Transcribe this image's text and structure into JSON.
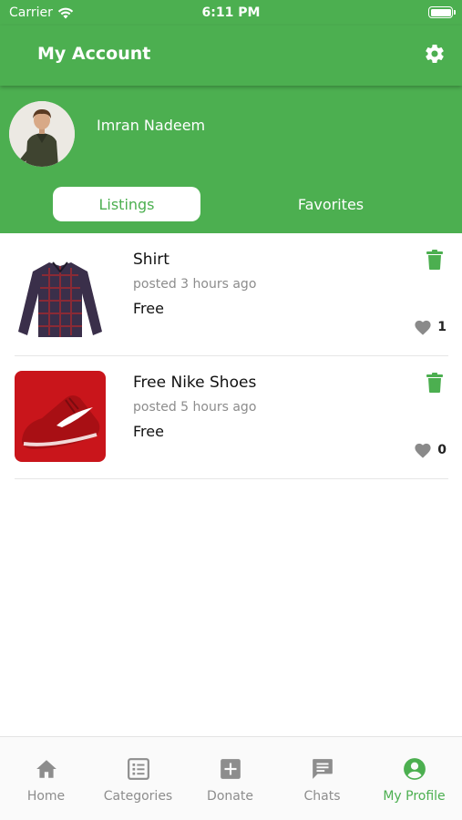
{
  "status_bar": {
    "carrier": "Carrier",
    "time": "6:11 PM"
  },
  "header": {
    "title": "My Account"
  },
  "profile": {
    "name": "Imran Nadeem"
  },
  "tabs": [
    {
      "label": "Listings",
      "active": true
    },
    {
      "label": "Favorites",
      "active": false
    }
  ],
  "listings": [
    {
      "title": "Shirt",
      "posted": "posted 3 hours ago",
      "price": "Free",
      "likes": "1"
    },
    {
      "title": "Free Nike Shoes",
      "posted": "posted 5 hours ago",
      "price": "Free",
      "likes": "0"
    }
  ],
  "tab_bar": [
    {
      "label": "Home",
      "icon": "home-icon"
    },
    {
      "label": "Categories",
      "icon": "list-icon"
    },
    {
      "label": "Donate",
      "icon": "plus-square-icon"
    },
    {
      "label": "Chats",
      "icon": "chat-icon"
    },
    {
      "label": "My Profile",
      "icon": "profile-icon",
      "selected": true
    }
  ],
  "colors": {
    "accent": "#4caf50",
    "muted": "#8d8d8d",
    "heart": "#8a8a8a"
  }
}
